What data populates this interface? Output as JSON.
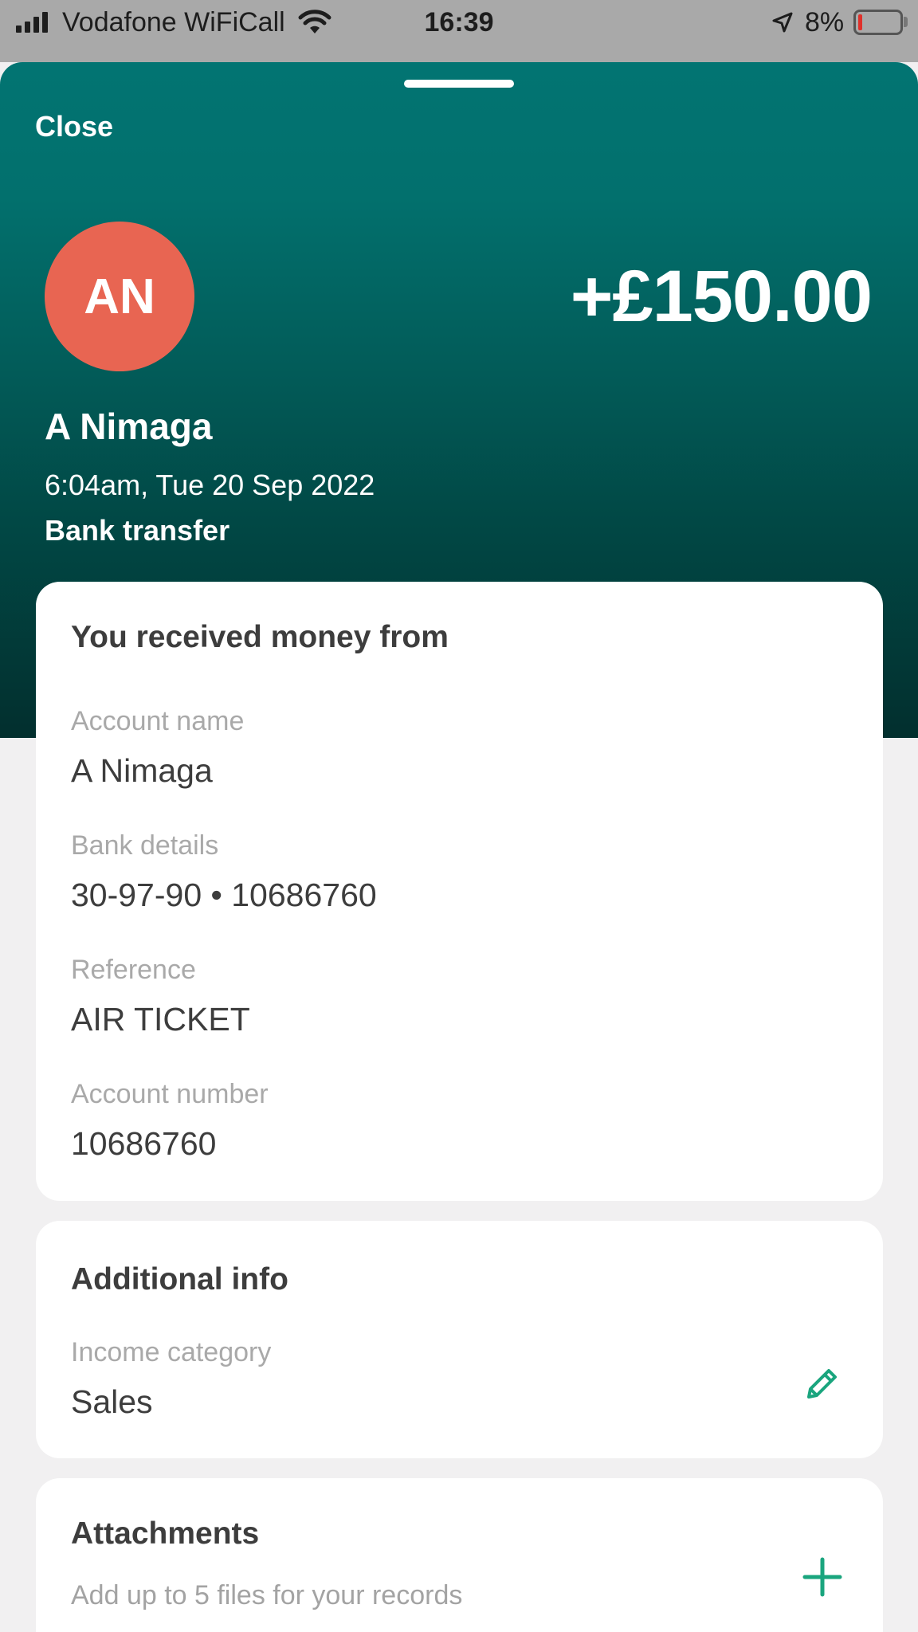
{
  "status_bar": {
    "carrier": "Vodafone WiFiCall",
    "time": "16:39",
    "battery_percent": "8%",
    "battery_level": 0.08,
    "icons": [
      "signal-icon",
      "wifi-icon",
      "location-arrow-icon",
      "battery-icon"
    ]
  },
  "header": {
    "close_label": "Close",
    "avatar_initials": "AN",
    "amount": "+£150.00",
    "payee_name": "A Nimaga",
    "datetime": "6:04am, Tue 20 Sep 2022",
    "method": "Bank transfer"
  },
  "received_card": {
    "title": "You received money from",
    "fields": [
      {
        "label": "Account name",
        "value": "A Nimaga"
      },
      {
        "label": "Bank details",
        "value": "30-97-90 • 10686760"
      },
      {
        "label": "Reference",
        "value": "AIR TICKET"
      },
      {
        "label": "Account number",
        "value": "10686760"
      }
    ]
  },
  "additional_card": {
    "title": "Additional info",
    "category_label": "Income category",
    "category_value": "Sales",
    "edit_icon": "pencil-icon"
  },
  "attachments_card": {
    "title": "Attachments",
    "subtitle": "Add up to 5 files for your records",
    "add_icon": "plus-icon"
  },
  "colors": {
    "accent": "#1aa57e",
    "header_teal": "#027472",
    "avatar": "#e86552"
  }
}
